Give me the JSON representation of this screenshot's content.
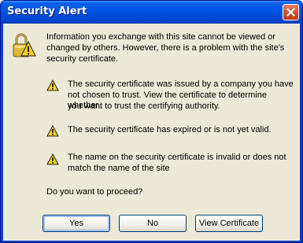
{
  "window": {
    "title": "Security Alert"
  },
  "intro": {
    "line1": "Information you exchange with this site cannot be viewed or",
    "line2": "changed by others. However, there is a problem with the site's",
    "line3": "security certificate."
  },
  "warnings": [
    {
      "line1": "The security certificate was issued by a company you have",
      "line2": "not chosen to trust. View the certificate to determine whether",
      "line3": "you want to trust the certifying authority."
    },
    {
      "line1": "The security certificate has expired or is not yet valid."
    },
    {
      "line1": "The name on the security certificate is invalid or does not",
      "line2": "match the name of the site"
    }
  ],
  "question": "Do you want to proceed?",
  "buttons": {
    "yes": "Yes",
    "no": "No",
    "view_certificate": "View Certificate"
  },
  "colors": {
    "titlebar": "#0055e5",
    "client": "#ece9d8",
    "warning_yellow": "#f7d21e"
  },
  "icons": {
    "main": "padlock-warning-icon",
    "warning": "warning-triangle-icon",
    "close": "close-icon"
  }
}
